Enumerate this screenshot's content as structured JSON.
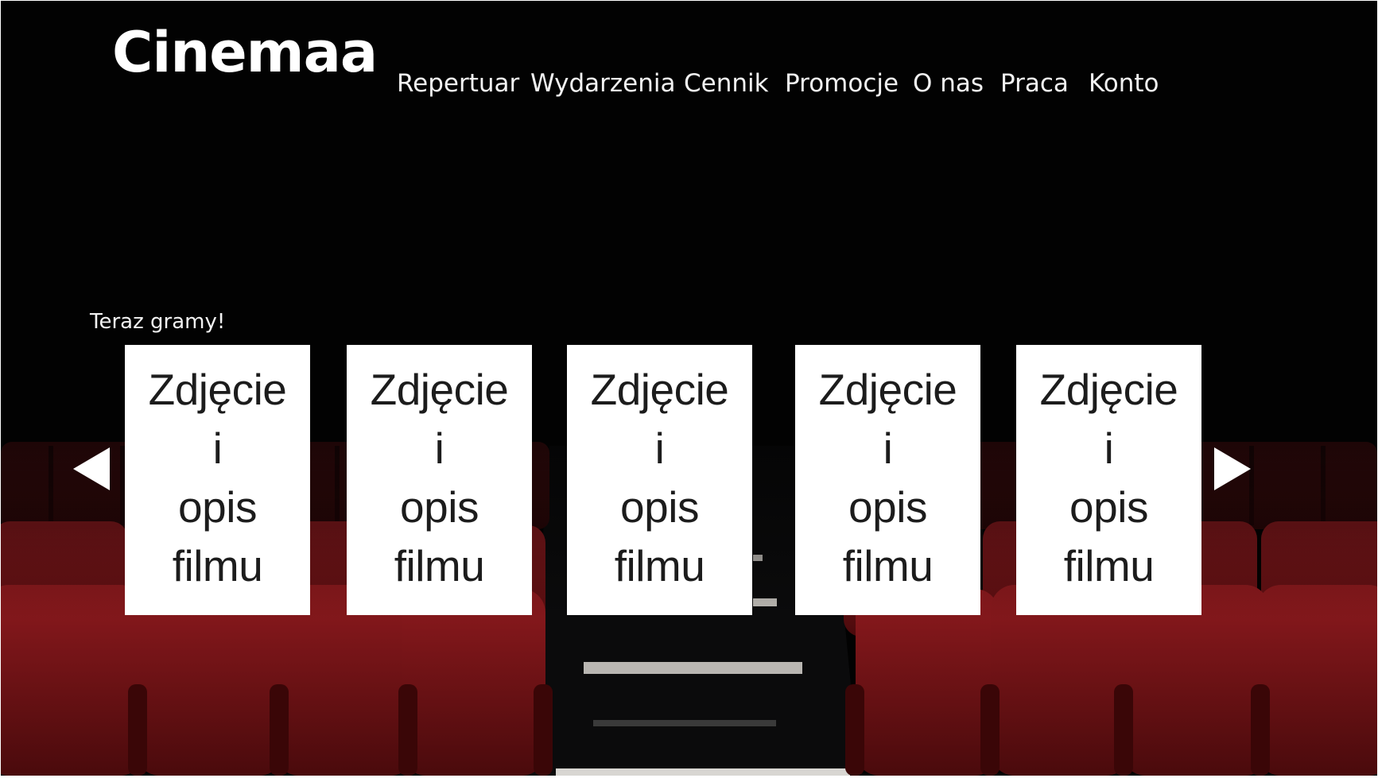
{
  "header": {
    "logo": "Cinemaa",
    "nav": [
      {
        "label": "Repertuar"
      },
      {
        "label": "Wydarzenia"
      },
      {
        "label": "Cennik"
      },
      {
        "label": "Promocje"
      },
      {
        "label": "O nas"
      },
      {
        "label": "Praca"
      },
      {
        "label": "Konto"
      }
    ]
  },
  "now_playing": {
    "title": "Teraz gramy!",
    "cards": [
      {
        "lines": [
          "Zdjęcie",
          "i",
          "opis",
          "filmu"
        ]
      },
      {
        "lines": [
          "Zdjęcie",
          "i",
          "opis",
          "filmu"
        ]
      },
      {
        "lines": [
          "Zdjęcie",
          "i",
          "opis",
          "filmu"
        ]
      },
      {
        "lines": [
          "Zdjęcie",
          "i",
          "opis",
          "filmu"
        ]
      },
      {
        "lines": [
          "Zdjęcie",
          "i",
          "opis",
          "filmu"
        ]
      }
    ],
    "prev_icon": "triangle-left-icon",
    "next_icon": "triangle-right-icon"
  },
  "colors": {
    "background": "#020202",
    "seat_red": "#7a1114",
    "card_background": "#ffffff",
    "text_light": "#ffffff"
  }
}
